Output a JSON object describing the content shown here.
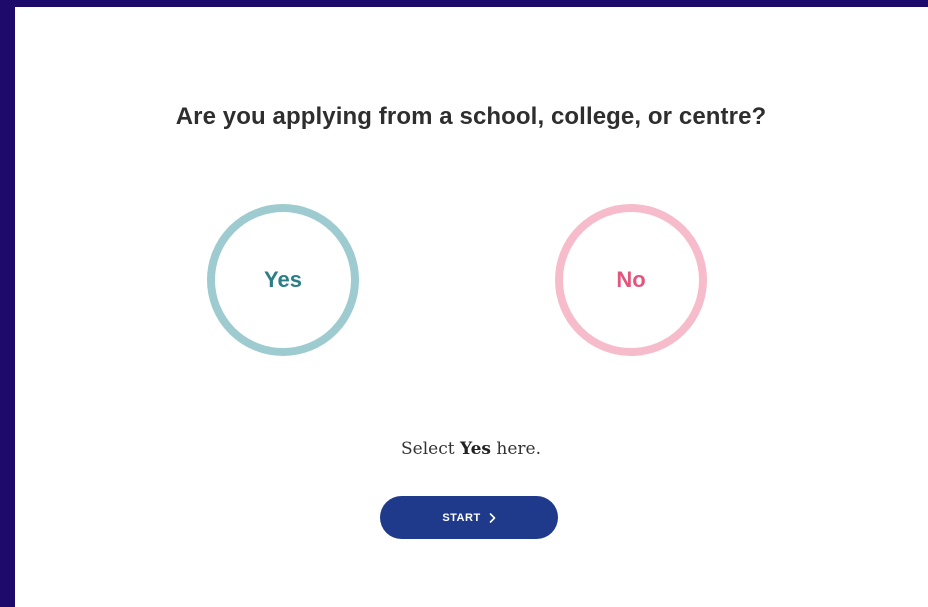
{
  "question": "Are you applying from a school, college, or centre?",
  "choices": {
    "yes": {
      "label": "Yes",
      "ring_color": "#9ecbcf",
      "text_color": "#2a7f86"
    },
    "no": {
      "label": "No",
      "ring_color": "#f7bccb",
      "text_color": "#e2557c"
    }
  },
  "hint": {
    "prefix": "Select ",
    "emphasis": "Yes",
    "suffix": " here."
  },
  "start_button": {
    "label": "START",
    "icon": "chevron-right-icon",
    "color": "#1f3a8a"
  },
  "frame_color": "#1d0a6b"
}
